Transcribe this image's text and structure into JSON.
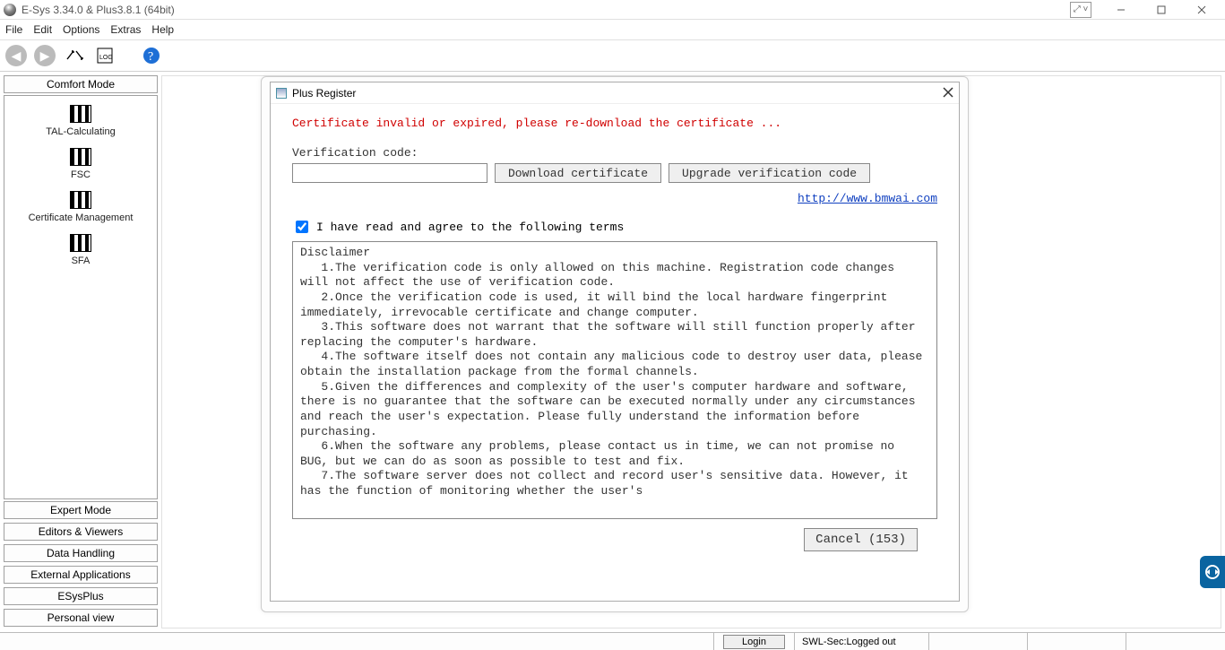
{
  "window": {
    "title": "E-Sys 3.34.0 & Plus3.8.1  (64bit)",
    "expand_glyph": "⤢ ˅"
  },
  "menubar": [
    "File",
    "Edit",
    "Options",
    "Extras",
    "Help"
  ],
  "toolbar": {
    "back_glyph": "◀",
    "fwd_glyph": "▶",
    "connect_glyph": "⇄",
    "log_label": "LOG",
    "help_glyph": "?"
  },
  "sidebar": {
    "comfort_mode": "Comfort Mode",
    "items": [
      {
        "label": "TAL-Calculating"
      },
      {
        "label": "FSC"
      },
      {
        "label": "Certificate Management"
      },
      {
        "label": "SFA"
      }
    ],
    "bottom": [
      "Expert Mode",
      "Editors & Viewers",
      "Data Handling",
      "External Applications",
      "ESysPlus",
      "Personal view"
    ]
  },
  "dialog": {
    "title": "Plus Register",
    "error": "Certificate  invalid or expired, please re-download the certificate ...",
    "verification_label": "Verification code:",
    "verification_value": "",
    "download_btn": "Download certificate",
    "upgrade_btn": "Upgrade verification code",
    "link_text": "http://www.bmwai.com",
    "agree_checked": true,
    "agree_label": "I have read and agree to the following terms",
    "terms_text": "Disclaimer\n   1.The verification code is only allowed on this machine. Registration code changes will not affect the use of verification code.\n   2.Once the verification code is used, it will bind the local hardware fingerprint immediately, irrevocable certificate and change computer.\n   3.This software does not warrant that the software will still function properly after replacing the computer's hardware.\n   4.The software itself does not contain any malicious code to destroy user data, please obtain the installation package from the formal channels.\n   5.Given the differences and complexity of the user's computer hardware and software, there is no guarantee that the software can be executed normally under any circumstances and reach the user's expectation. Please fully understand the information before purchasing.\n   6.When the software any problems, please contact us in time, we can not promise no BUG, but we can do as soon as possible to test and fix.\n   7.The software server does not collect and record user's sensitive data. However, it has the function of monitoring whether the user's",
    "cancel_btn": "Cancel (153)"
  },
  "statusbar": {
    "login_btn": "Login",
    "swl_label": "SWL-Sec: ",
    "swl_value": "Logged out"
  },
  "tv_glyph": "↔"
}
